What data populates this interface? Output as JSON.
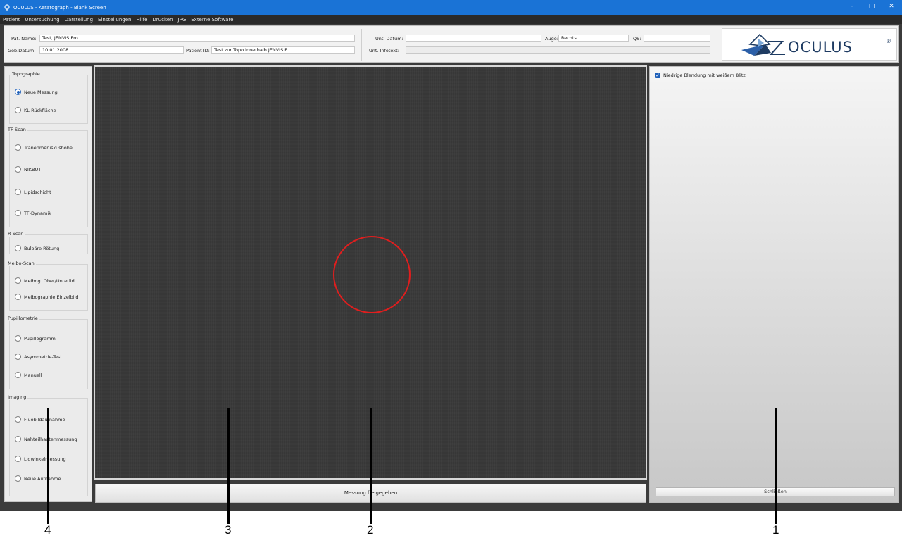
{
  "window": {
    "title": "OCULUS - Keratograph - Blank Screen",
    "controls": {
      "minimize": "–",
      "maximize": "▢",
      "close": "✕"
    }
  },
  "menu": [
    "Patient",
    "Untersuchung",
    "Darstellung",
    "Einstellungen",
    "Hilfe",
    "Drucken",
    "JPG",
    "Externe Software"
  ],
  "header": {
    "pat_name_label": "Pat. Name:",
    "pat_name": "Test, JENVIS Pro",
    "geb_datum_label": "Geb.Datum:",
    "geb_datum": "10.01.2008",
    "patient_id_label": "Patient ID:",
    "patient_id": "Test zur Topo innerhalb JENVIS P",
    "unt_datum_label": "Unt. Datum:",
    "unt_datum": "",
    "auge_label": "Auge:",
    "auge": "Rechts",
    "qs_label": "QS:",
    "qs": "",
    "unt_infotext_label": "Unt. Infotext:",
    "unt_infotext": ""
  },
  "logo": {
    "text": "OCULUS",
    "reg": "®",
    "brand_color": "#1e3b62"
  },
  "left_panel": {
    "groups": [
      {
        "title": "Topographie",
        "options": [
          {
            "label": "Neue Messung",
            "selected": true
          },
          {
            "label": "KL-Rückfläche",
            "selected": false
          }
        ]
      },
      {
        "title": "TF-Scan",
        "options": [
          {
            "label": "Tränenmeniskushöhe",
            "selected": false
          },
          {
            "label": "NIKBUT",
            "selected": false
          },
          {
            "label": "Lipidschicht",
            "selected": false
          },
          {
            "label": "TF-Dynamik",
            "selected": false
          }
        ]
      },
      {
        "title": "R-Scan",
        "options": [
          {
            "label": "Bulbäre Rötung",
            "selected": false
          }
        ]
      },
      {
        "title": "Meibo-Scan",
        "options": [
          {
            "label": "Meibog. Ober/Unterlid",
            "selected": false
          },
          {
            "label": "Meibographie Einzelbild",
            "selected": false
          }
        ]
      },
      {
        "title": "Pupillometrie",
        "options": [
          {
            "label": "Pupillogramm",
            "selected": false
          },
          {
            "label": "Asymmetrie-Test",
            "selected": false
          },
          {
            "label": "Manuell",
            "selected": false
          }
        ]
      },
      {
        "title": "Imaging",
        "options": [
          {
            "label": "Fluobildaufnahme",
            "selected": false
          },
          {
            "label": "Nahteilhautenmessung",
            "selected": false
          },
          {
            "label": "Lidwinkelmessung",
            "selected": false
          },
          {
            "label": "Neue Aufnahme",
            "selected": false
          }
        ]
      }
    ]
  },
  "camera": {
    "target_color": "#e01e1e"
  },
  "release_button": "Messung freigegeben",
  "right_panel": {
    "checkbox_label": "Niedrige Blendung mit weißem Blitz",
    "checkbox_checked": true,
    "close_button": "Schließen"
  },
  "callouts": [
    "1",
    "2",
    "3",
    "4"
  ],
  "colors": {
    "titlebar": "#1a73d6",
    "accent": "#1e5fb8"
  }
}
